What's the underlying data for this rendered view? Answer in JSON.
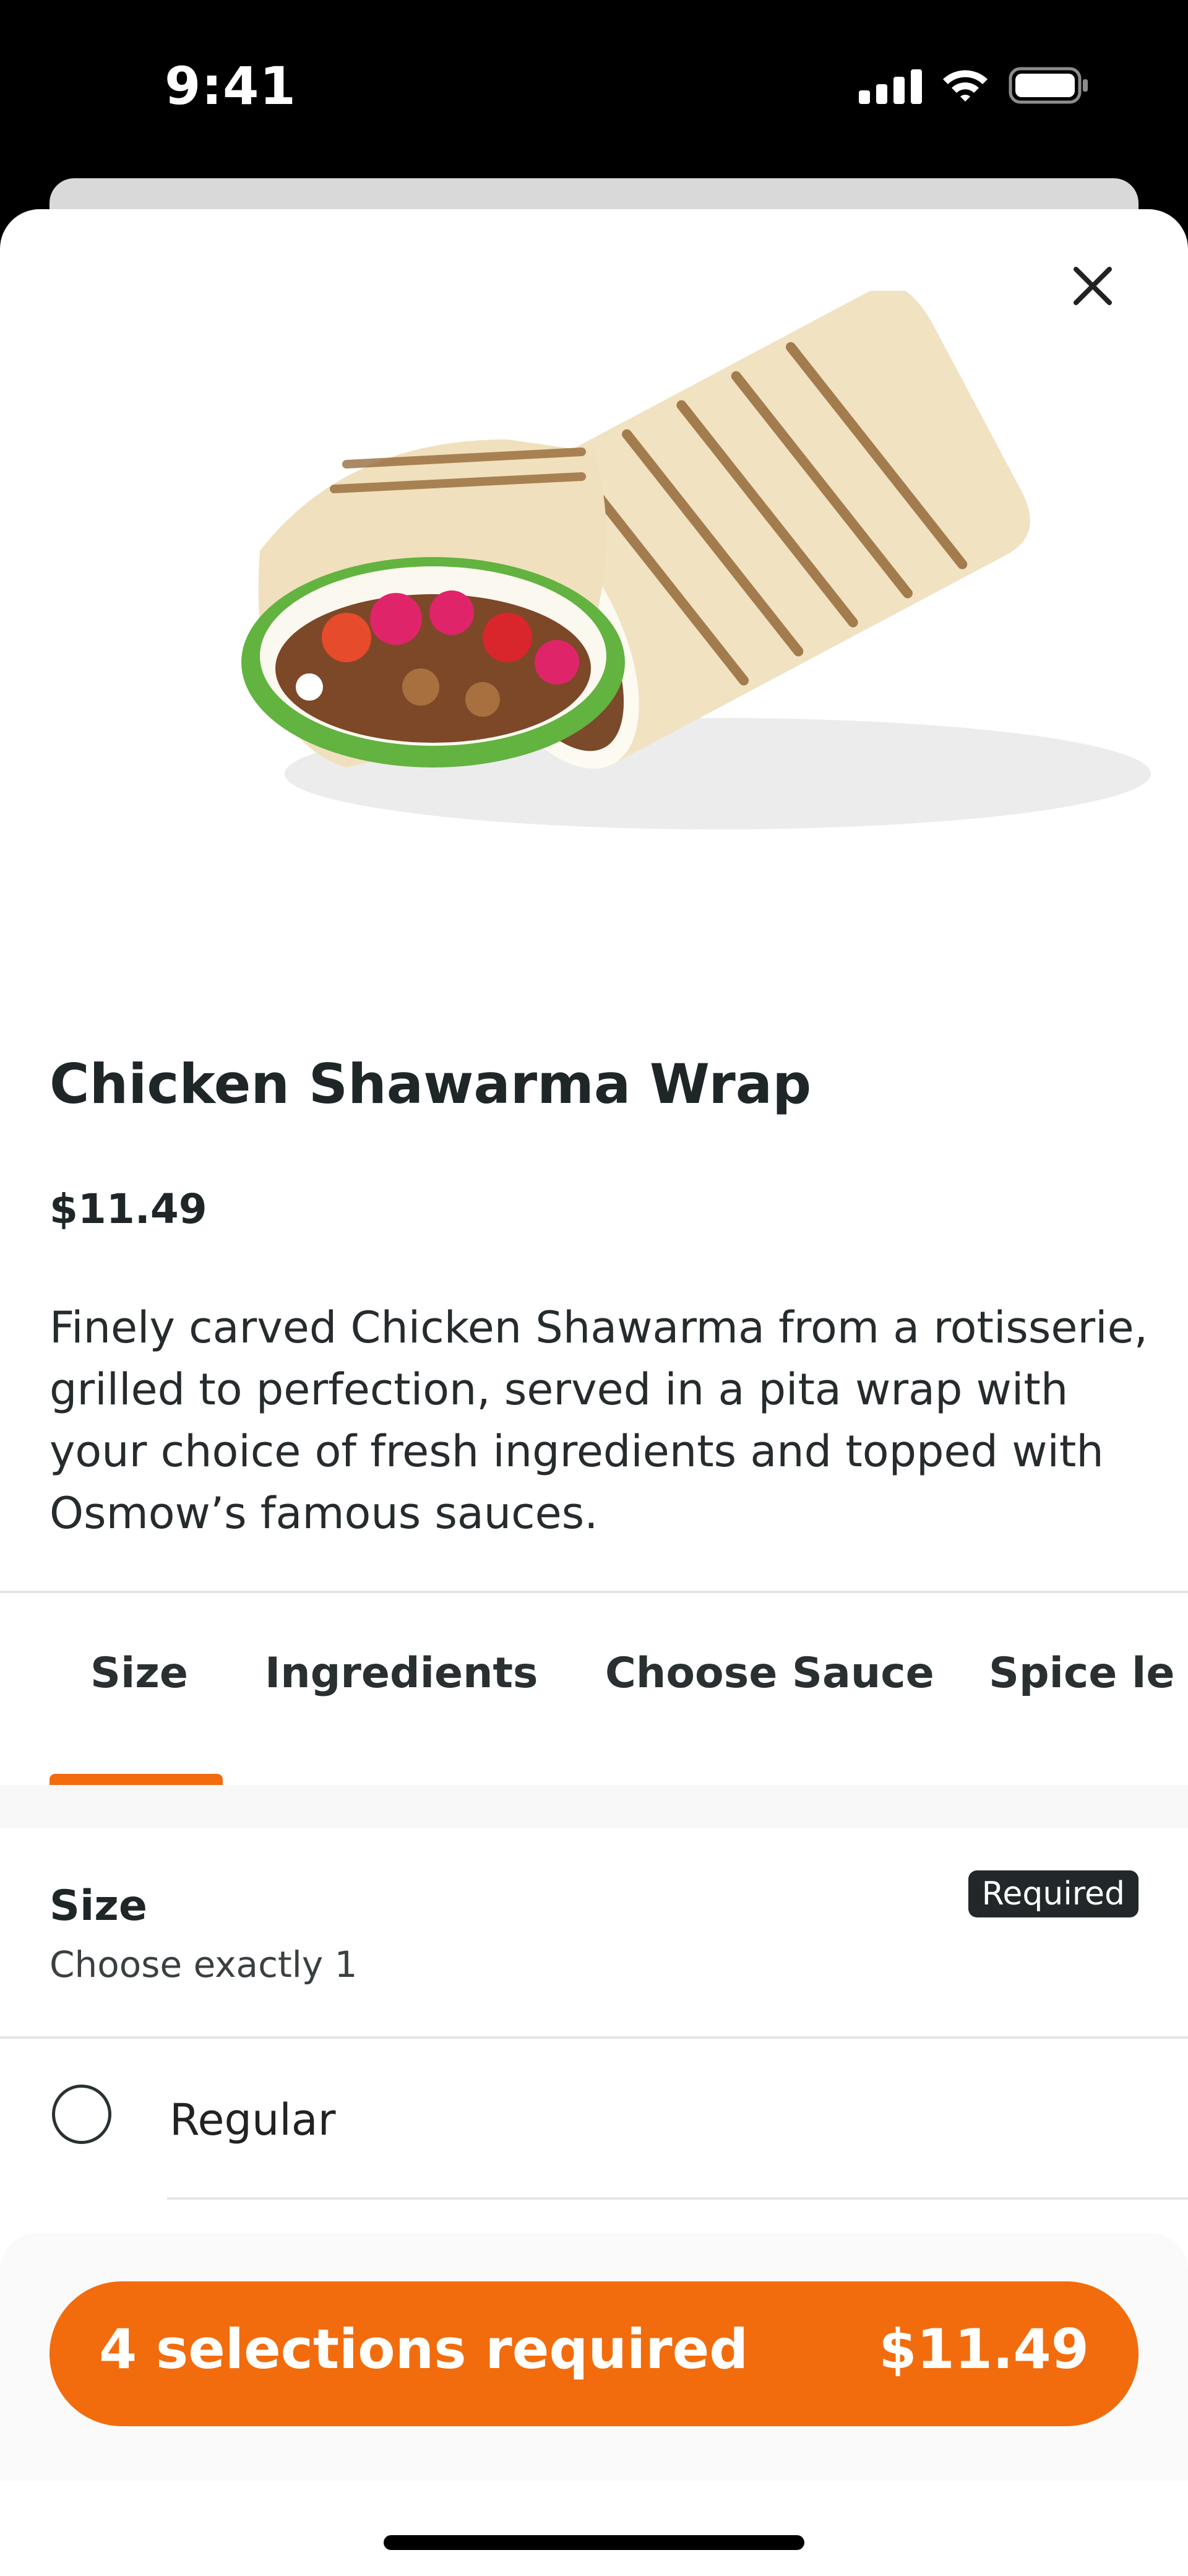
{
  "status_bar": {
    "time": "9:41",
    "icons": [
      "cellular-signal-icon",
      "wifi-icon",
      "battery-icon"
    ]
  },
  "product": {
    "image": "chicken-shawarma-wrap-photo",
    "title": "Chicken Shawarma Wrap",
    "price": "$11.49",
    "description": "Finely carved Chicken Shawarma from a rotisserie, grilled to perfection, served in a pita wrap with your choice of fresh ingredients and topped with Osmow’s famous sauces."
  },
  "tabs": [
    {
      "label": "Size",
      "active": true
    },
    {
      "label": "Ingredients",
      "active": false
    },
    {
      "label": "Choose Sauce",
      "active": false
    },
    {
      "label": "Spice le",
      "active": false
    }
  ],
  "section": {
    "title": "Size",
    "subtitle": "Choose exactly 1",
    "badge": "Required",
    "options": [
      {
        "label": "Regular",
        "selected": false
      }
    ]
  },
  "cta": {
    "label": "4 selections required",
    "price": "$11.49"
  },
  "colors": {
    "accent": "#f26c0d",
    "text": "#1f2628",
    "badge_bg": "#22282a"
  }
}
